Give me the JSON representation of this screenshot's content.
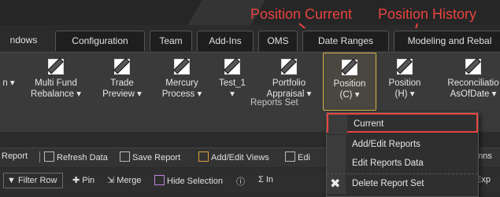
{
  "callouts": {
    "position_current": "Position Current",
    "position_history": "Position History"
  },
  "tabs": [
    "ndows",
    "Configuration",
    "Team",
    "Add-Ins",
    "OMS",
    "Date Ranges",
    "Modeling and Rebal"
  ],
  "ribbon": {
    "buttons": [
      {
        "line1": "",
        "line2": "n ▾"
      },
      {
        "line1": "Multi Fund",
        "line2": "Rebalance ▾"
      },
      {
        "line1": "Trade",
        "line2": "Preview ▾"
      },
      {
        "line1": "Mercury",
        "line2": "Process ▾"
      },
      {
        "line1": "Test_1",
        "line2": "▾"
      },
      {
        "line1": "Portfolio",
        "line2": "Appraisal ▾"
      },
      {
        "line1": "Position",
        "line2": "(C) ▾"
      },
      {
        "line1": "Position",
        "line2": "(H) ▾"
      },
      {
        "line1": "Reconciliatio",
        "line2": "AsOfDate ▾"
      }
    ],
    "group_label": "Reports Set"
  },
  "toolbar1": {
    "report": "Report",
    "refresh": "Refresh Data",
    "save": "Save Report",
    "add_edit_views": "Add/Edit Views",
    "edit_trunc": "Edi",
    "columns_trunc": "umns"
  },
  "toolbar2": {
    "filter_row": "Filter Row",
    "pin": "Pin",
    "merge": "Merge",
    "hide_selection": "Hide Selection",
    "in_trunc": "In",
    "exp_trunc": "Exp"
  },
  "menu": {
    "items": [
      "Current",
      "Add/Edit Reports",
      "Edit Reports Data",
      "Delete Report Set"
    ]
  },
  "colors": {
    "accent_red": "#e8433f",
    "highlight_gold": "#d4b24a"
  }
}
